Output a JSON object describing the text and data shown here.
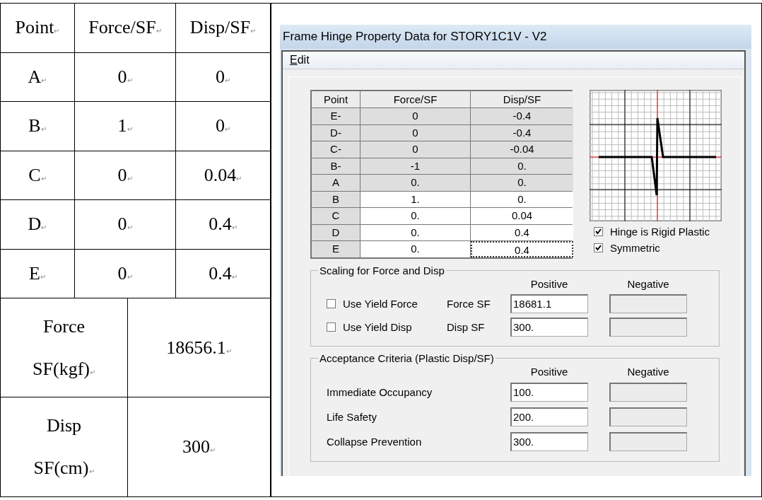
{
  "doc_table": {
    "columns": [
      {
        "text": "Point",
        "mark": "↵"
      },
      {
        "text": "Force/SF",
        "mark": "↵"
      },
      {
        "text": "Disp/SF",
        "mark": "↵"
      }
    ],
    "rows": [
      [
        {
          "text": "A",
          "mark": "↵"
        },
        {
          "text": "0",
          "mark": "↵"
        },
        {
          "text": "0",
          "mark": "↵"
        }
      ],
      [
        {
          "text": "B",
          "mark": "↵"
        },
        {
          "text": "1",
          "mark": "↵"
        },
        {
          "text": "0",
          "mark": "↵"
        }
      ],
      [
        {
          "text": "C",
          "mark": "↵"
        },
        {
          "text": "0",
          "mark": "↵"
        },
        {
          "text": "0.04",
          "mark": "↵"
        }
      ],
      [
        {
          "text": "D",
          "mark": "↵"
        },
        {
          "text": "0",
          "mark": "↵"
        },
        {
          "text": "0.4",
          "mark": "↵"
        }
      ],
      [
        {
          "text": "E",
          "mark": "↵"
        },
        {
          "text": "0",
          "mark": "↵"
        },
        {
          "text": "0.4",
          "mark": "↵"
        }
      ]
    ],
    "scale_rows": [
      {
        "label_lines": [
          {
            "text": "Force"
          },
          {
            "text": "SF(kgf)",
            "mark": "↵"
          }
        ],
        "value": {
          "text": "18656.1",
          "mark": "↵"
        }
      },
      {
        "label_lines": [
          {
            "text": "Disp"
          },
          {
            "text": "SF(cm)",
            "mark": "↵"
          }
        ],
        "value": {
          "text": "300",
          "mark": "↵"
        }
      }
    ]
  },
  "dialog": {
    "title": "Frame Hinge Property Data for STORY1C1V - V2",
    "menu": [
      "Edit"
    ],
    "table": {
      "columns": [
        "Point",
        "Force/SF",
        "Disp/SF"
      ],
      "rows": [
        {
          "point": "E-",
          "force": "0",
          "disp": "-0.4",
          "editable": false,
          "focused": false
        },
        {
          "point": "D-",
          "force": "0",
          "disp": "-0.4",
          "editable": false,
          "focused": false
        },
        {
          "point": "C-",
          "force": "0",
          "disp": "-0.04",
          "editable": false,
          "focused": false
        },
        {
          "point": "B-",
          "force": "-1",
          "disp": "0.",
          "editable": false,
          "focused": false
        },
        {
          "point": "A",
          "force": "0.",
          "disp": "0.",
          "editable": false,
          "focused": false
        },
        {
          "point": "B",
          "force": "1.",
          "disp": "0.",
          "editable": true,
          "focused": false
        },
        {
          "point": "C",
          "force": "0.",
          "disp": "0.04",
          "editable": true,
          "focused": false
        },
        {
          "point": "D",
          "force": "0.",
          "disp": "0.4",
          "editable": true,
          "focused": false
        },
        {
          "point": "E",
          "force": "0.",
          "disp": "0.4",
          "editable": true,
          "focused": true
        }
      ]
    },
    "options": [
      {
        "label": "Hinge is Rigid Plastic",
        "checked": true
      },
      {
        "label": "Symmetric",
        "checked": true
      }
    ],
    "scaling": {
      "title": "Scaling for Force and Disp",
      "positive_header": "Positive",
      "negative_header": "Negative",
      "rows": [
        {
          "check_label": "Use Yield Force",
          "checked": false,
          "label": "Force SF",
          "positive": "18681.1",
          "negative_disabled": true
        },
        {
          "check_label": "Use Yield Disp",
          "checked": false,
          "label": "Disp SF",
          "positive": "300.",
          "negative_disabled": true
        }
      ]
    },
    "acceptance": {
      "title": "Acceptance Criteria (Plastic Disp/SF)",
      "positive_header": "Positive",
      "negative_header": "Negative",
      "rows": [
        {
          "label": "Immediate Occupancy",
          "positive": "100.",
          "negative_disabled": true
        },
        {
          "label": "Life Safety",
          "positive": "200.",
          "negative_disabled": true
        },
        {
          "label": "Collapse Prevention",
          "positive": "300.",
          "negative_disabled": true
        }
      ]
    }
  }
}
